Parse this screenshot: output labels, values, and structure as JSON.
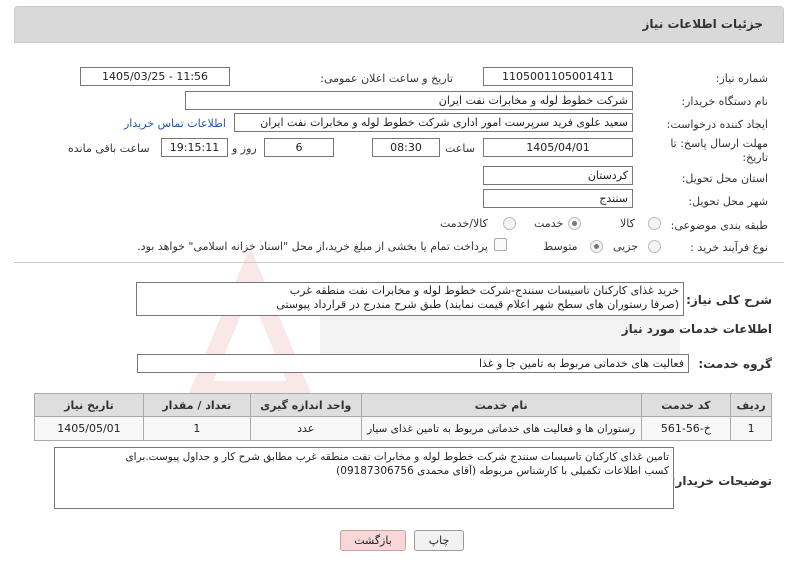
{
  "header": {
    "title": "جزئیات اطلاعات نیاز"
  },
  "fields": {
    "need_number_label": "شماره نیاز:",
    "need_number": "1105001105001411",
    "announce_label": "تاریخ و ساعت اعلان عمومی:",
    "announce_value": "1405/03/25 - 11:56",
    "buyer_label": "نام دستگاه خریدار:",
    "buyer_value": "شرکت خطوط لوله و مخابرات نفت ایران",
    "creator_label": "ایجاد کننده درخواست:",
    "creator_value": "سعید علوی فرید سرپرست امور اداری  شرکت خطوط لوله و مخابرات نفت ایران",
    "contact_link": "اطلاعات تماس خریدار",
    "deadline_label": "مهلت ارسال پاسخ: تا تاریخ:",
    "deadline_date": "1405/04/01",
    "time_label": "ساعت",
    "deadline_time": "08:30",
    "days_value": "6",
    "days_label": "روز و",
    "remaining_time": "19:15:11",
    "remaining_label": "ساعت باقی مانده",
    "province_label": "استان محل تحویل:",
    "province_value": "کردستان",
    "city_label": "شهر محل تحویل:",
    "city_value": "سنندج",
    "category_label": "طبقه بندی موضوعی:",
    "category_options": [
      "کالا",
      "خدمت",
      "کالا/خدمت"
    ],
    "process_label": "نوع فرآیند خرید :",
    "process_options": [
      "جزیی",
      "متوسط"
    ],
    "payment_note": "پرداخت تمام یا بخشی از مبلغ خرید،از محل \"اسناد خزانه اسلامی\" خواهد بود."
  },
  "summary": {
    "label": "شرح کلی نیاز:",
    "line1": "خرید غذای کارکنان تاسیسات سنندج-شرکت خطوط لوله و مخابرات نفت منطقه غرب",
    "line2": "(صرفا رستوران های سطح شهر اعلام قیمت نمایند) طبق شرح مندرج در قرارداد پیوستی"
  },
  "services": {
    "section_title": "اطلاعات خدمات مورد نیاز",
    "group_label": "گروه خدمت:",
    "group_value": "فعالیت های خدماتی مربوط به تامین جا و غذا",
    "columns": [
      "ردیف",
      "کد خدمت",
      "نام خدمت",
      "واحد اندازه گیری",
      "تعداد / مقدار",
      "تاریخ نیاز"
    ],
    "rows": [
      [
        "1",
        "خ-56-561",
        "رستوران ها و فعالیت های خدماتی مربوط به تامین غذای سیار",
        "عدد",
        "1",
        "1405/05/01"
      ]
    ]
  },
  "buyer_notes": {
    "label": "توضیحات خریدار:",
    "line1": "تامین غذای کارکنان تاسیسات سنندج شرکت خطوط لوله و مخابرات نفت منطقه غرب مطابق شرح کار و جداول پیوست.برای",
    "line2": "کسب اطلاعات  تکمیلی با کارشناس مربوطه (آقای محمدی 09187306756)"
  },
  "buttons": {
    "print": "چاپ",
    "back": "بازگشت"
  },
  "colors": {
    "header_bg": "#d9d9d9",
    "back_button_bg": "#f7d7d7",
    "link": "#2255aa"
  }
}
